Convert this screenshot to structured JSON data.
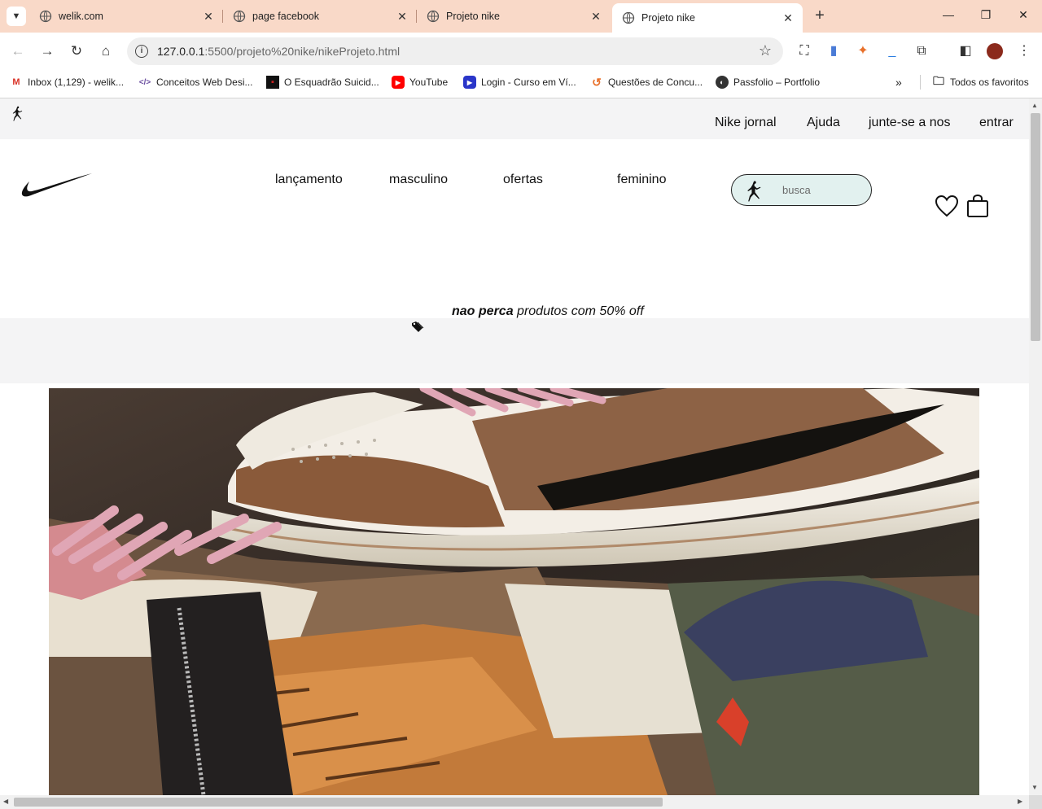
{
  "browser": {
    "tabs": [
      {
        "title": "welik.com"
      },
      {
        "title": "page facebook"
      },
      {
        "title": "Projeto nike"
      },
      {
        "title": "Projeto nike",
        "active": true
      }
    ],
    "url": {
      "host": "127.0.0.1",
      "path": ":5500/projeto%20nike/nikeProjeto.html"
    },
    "bookmarks": [
      {
        "label": "Inbox (1,129) - welik...",
        "icon": "gmail-icon"
      },
      {
        "label": "Conceitos Web Desi...",
        "icon": "code-icon"
      },
      {
        "label": "O Esquadrão Suicid...",
        "icon": "movie-icon"
      },
      {
        "label": "YouTube",
        "icon": "youtube-icon"
      },
      {
        "label": "Login - Curso em Ví...",
        "icon": "course-icon"
      },
      {
        "label": "Questões de Concu...",
        "icon": "questions-icon"
      },
      {
        "label": "Passfolio – Portfolio",
        "icon": "passfolio-icon"
      }
    ],
    "all_bookmarks_label": "Todos os favoritos",
    "colors": {
      "tabbar": "#f9d9c8"
    }
  },
  "page": {
    "topnav": {
      "items": [
        "Nike jornal",
        "Ajuda",
        "junte-se a nos",
        "entrar"
      ]
    },
    "mainnav": {
      "items": [
        "lançamento",
        "masculino",
        "ofertas",
        "feminino"
      ]
    },
    "search": {
      "placeholder": "busca",
      "background": "#e2f1ef"
    },
    "promo": {
      "bold": "nao perca",
      "text": " produtos com 50% off"
    },
    "hero": {
      "image": "sneakers-photo"
    }
  }
}
